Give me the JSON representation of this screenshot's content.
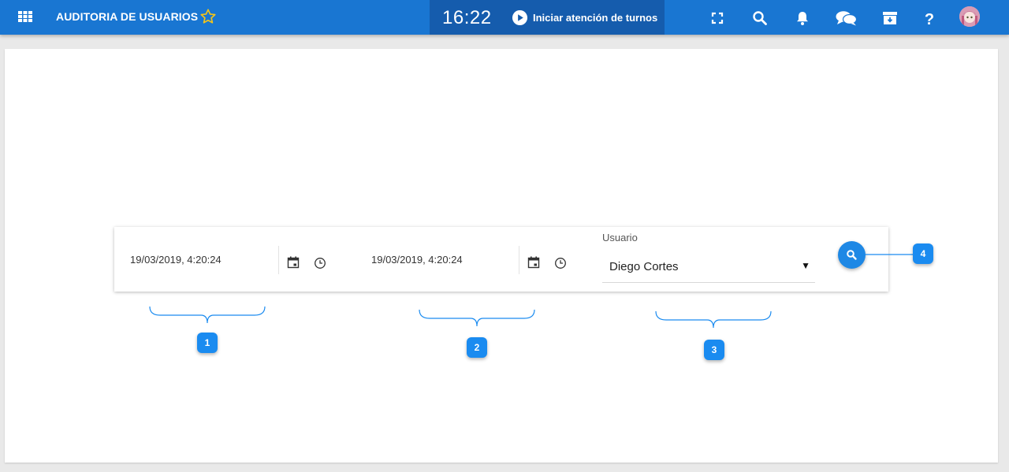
{
  "header": {
    "title": "AUDITORIA DE USUARIOS",
    "time": "16:22",
    "turnos_label": "Iniciar atención de turnos"
  },
  "icons": [
    "apps-grid-icon",
    "star-icon",
    "play-icon",
    "fullscreen-icon",
    "search-icon",
    "bell-icon",
    "chat-icon",
    "archive-icon",
    "help-icon",
    "avatar"
  ],
  "filters": {
    "from_date": "19/03/2019, 4:20:24",
    "to_date": "19/03/2019, 4:20:24",
    "user_label": "Usuario",
    "user_value": "Diego Cortes"
  },
  "annotations": {
    "badge1": "1",
    "badge2": "2",
    "badge3": "3",
    "badge4": "4"
  },
  "colors": {
    "topbar": "#1976d2",
    "clock_block": "#155cad",
    "accent": "#1e88e5",
    "badge": "#1a8bf0",
    "star": "#f5c518"
  }
}
